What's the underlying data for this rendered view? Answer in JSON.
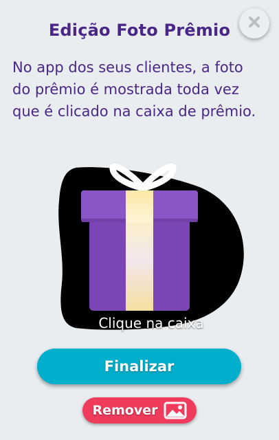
{
  "modal": {
    "title": "Edição Foto Prêmio",
    "description": "No app dos seus clientes, a foto do prêmio é mostrada toda vez que é clicado na caixa de prêmio.",
    "close_icon": "close-icon",
    "prize_box": {
      "label": "Clique na caixa",
      "icon": "gift-box-icon",
      "colors": {
        "box": "#7b45b6",
        "lid": "#8a55c4",
        "ribbon": "#f7e7b2",
        "bow": "#ffffff",
        "blob": "#000000"
      }
    },
    "finalize_button": {
      "label": "Finalizar",
      "color": "#00afcb"
    },
    "remove_button": {
      "label": "Remover",
      "icon": "image-icon",
      "color": "#ef3b5c"
    }
  }
}
